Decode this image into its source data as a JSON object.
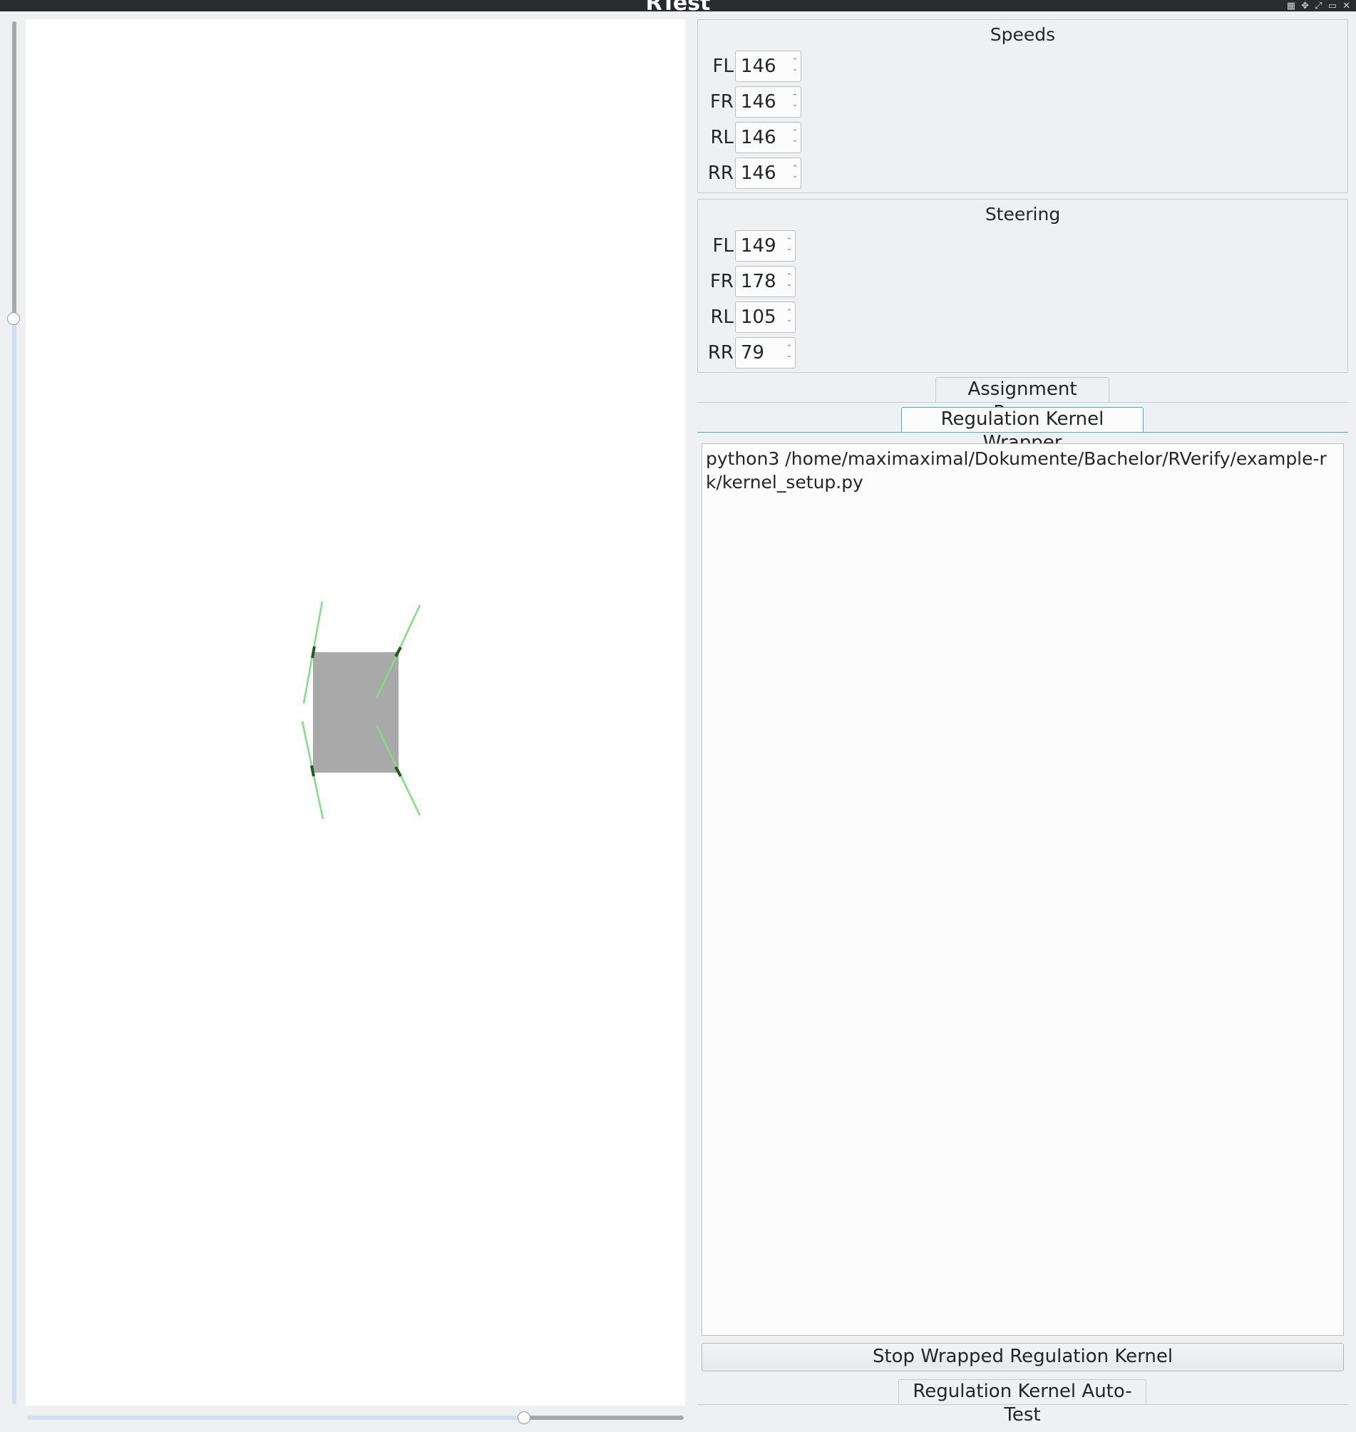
{
  "window": {
    "title": "RTest",
    "controls": "▦ ✥ ⤢ ▭ ✕"
  },
  "speeds": {
    "title": "Speeds",
    "rows": [
      {
        "label": "FL",
        "value": "146"
      },
      {
        "label": "FR",
        "value": "146"
      },
      {
        "label": "RL",
        "value": "146"
      },
      {
        "label": "RR",
        "value": "146"
      }
    ]
  },
  "steering": {
    "title": "Steering",
    "rows": [
      {
        "label": "FL",
        "value": "149"
      },
      {
        "label": "FR",
        "value": "178"
      },
      {
        "label": "RL",
        "value": "105"
      },
      {
        "label": "RR",
        "value": "79"
      }
    ]
  },
  "tabs": {
    "assignment_parser": "Assignment Parser",
    "regulation_kernel_wrapper": "Regulation Kernel Wrapper",
    "regulation_kernel_autotest": "Regulation Kernel Auto-Test"
  },
  "wrapper": {
    "command": "python3 /home/maximaximal/Dokumente/Bachelor/RVerify/example-rk/kernel_setup.py",
    "stop_button": "Stop Wrapped Regulation Kernel"
  },
  "colors": {
    "car_body": "#a9a9a9",
    "wheel_line": "#7ee07e",
    "accent": "#3daee9"
  },
  "icons": {
    "spin_arrows": "up-down-arrows-icon"
  }
}
